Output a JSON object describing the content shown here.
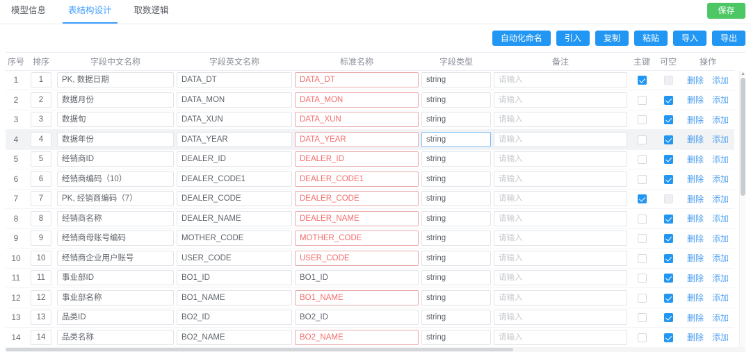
{
  "tabs": [
    {
      "label": "模型信息",
      "active": false
    },
    {
      "label": "表结构设计",
      "active": true
    },
    {
      "label": "取数逻辑",
      "active": false
    }
  ],
  "save_label": "保存",
  "toolbar": {
    "buttons": [
      "自动化命名",
      "引入",
      "复制",
      "粘贴",
      "导入",
      "导出"
    ]
  },
  "table": {
    "headers": [
      "序号",
      "排序",
      "字段中文名称",
      "字段英文名称",
      "标准名称",
      "字段类型",
      "备注",
      "主键",
      "可空",
      "操作"
    ],
    "note_placeholder": "请输入",
    "action_delete": "删除",
    "action_add": "添加",
    "rows": [
      {
        "no": "1",
        "sort": "1",
        "cn": "PK, 数据日期",
        "en": "DATA_DT",
        "std": "DATA_DT",
        "std_err": true,
        "type": "string",
        "type_focus": false,
        "note": "",
        "pk": true,
        "pk_dis": false,
        "nullable": false,
        "null_dis": true,
        "hl": false
      },
      {
        "no": "2",
        "sort": "2",
        "cn": "数据月份",
        "en": "DATA_MON",
        "std": "DATA_MON",
        "std_err": true,
        "type": "string",
        "type_focus": false,
        "note": "",
        "pk": false,
        "pk_dis": false,
        "nullable": true,
        "null_dis": false,
        "hl": false
      },
      {
        "no": "3",
        "sort": "3",
        "cn": "数据旬",
        "en": "DATA_XUN",
        "std": "DATA_XUN",
        "std_err": true,
        "type": "string",
        "type_focus": false,
        "note": "",
        "pk": false,
        "pk_dis": false,
        "nullable": true,
        "null_dis": false,
        "hl": false
      },
      {
        "no": "4",
        "sort": "4",
        "cn": "数据年份",
        "en": "DATA_YEAR",
        "std": "DATA_YEAR",
        "std_err": true,
        "type": "string",
        "type_focus": true,
        "note": "",
        "pk": false,
        "pk_dis": false,
        "nullable": true,
        "null_dis": false,
        "hl": true
      },
      {
        "no": "5",
        "sort": "5",
        "cn": "经销商ID",
        "en": "DEALER_ID",
        "std": "DEALER_ID",
        "std_err": true,
        "type": "string",
        "type_focus": false,
        "note": "",
        "pk": false,
        "pk_dis": false,
        "nullable": true,
        "null_dis": false,
        "hl": false
      },
      {
        "no": "6",
        "sort": "6",
        "cn": "经销商编码（10）",
        "en": "DEALER_CODE1",
        "std": "DEALER_CODE1",
        "std_err": true,
        "type": "string",
        "type_focus": false,
        "note": "",
        "pk": false,
        "pk_dis": false,
        "nullable": true,
        "null_dis": false,
        "hl": false
      },
      {
        "no": "7",
        "sort": "7",
        "cn": "PK, 经销商编码（7）",
        "en": "DEALER_CODE",
        "std": "DEALER_CODE",
        "std_err": true,
        "type": "string",
        "type_focus": false,
        "note": "",
        "pk": true,
        "pk_dis": false,
        "nullable": false,
        "null_dis": true,
        "hl": false
      },
      {
        "no": "8",
        "sort": "8",
        "cn": "经销商名称",
        "en": "DEALER_NAME",
        "std": "DEALER_NAME",
        "std_err": true,
        "type": "string",
        "type_focus": false,
        "note": "",
        "pk": false,
        "pk_dis": false,
        "nullable": true,
        "null_dis": false,
        "hl": false
      },
      {
        "no": "9",
        "sort": "9",
        "cn": "经销商母账号编码",
        "en": "MOTHER_CODE",
        "std": "MOTHER_CODE",
        "std_err": true,
        "type": "string",
        "type_focus": false,
        "note": "",
        "pk": false,
        "pk_dis": false,
        "nullable": true,
        "null_dis": false,
        "hl": false
      },
      {
        "no": "10",
        "sort": "10",
        "cn": "经销商企业用户账号",
        "en": "USER_CODE",
        "std": "USER_CODE",
        "std_err": true,
        "type": "string",
        "type_focus": false,
        "note": "",
        "pk": false,
        "pk_dis": false,
        "nullable": true,
        "null_dis": false,
        "hl": false
      },
      {
        "no": "11",
        "sort": "11",
        "cn": "事业部ID",
        "en": "BO1_ID",
        "std": "BO1_ID",
        "std_err": false,
        "type": "string",
        "type_focus": false,
        "note": "",
        "pk": false,
        "pk_dis": false,
        "nullable": true,
        "null_dis": false,
        "hl": false
      },
      {
        "no": "12",
        "sort": "12",
        "cn": "事业部名称",
        "en": "BO1_NAME",
        "std": "BO1_NAME",
        "std_err": true,
        "type": "string",
        "type_focus": false,
        "note": "",
        "pk": false,
        "pk_dis": false,
        "nullable": true,
        "null_dis": false,
        "hl": false
      },
      {
        "no": "13",
        "sort": "13",
        "cn": "品类ID",
        "en": "BO2_ID",
        "std": "BO2_ID",
        "std_err": false,
        "type": "string",
        "type_focus": false,
        "note": "",
        "pk": false,
        "pk_dis": false,
        "nullable": true,
        "null_dis": false,
        "hl": false
      },
      {
        "no": "14",
        "sort": "14",
        "cn": "品类名称",
        "en": "BO2_NAME",
        "std": "BO2_NAME",
        "std_err": true,
        "type": "string",
        "type_focus": false,
        "note": "",
        "pk": false,
        "pk_dis": false,
        "nullable": true,
        "null_dis": false,
        "hl": false
      }
    ]
  },
  "colors": {
    "accent": "#409eff",
    "button_blue": "#2196f3",
    "save_green": "#4cc764",
    "error_red": "#f56c6c"
  },
  "scroll": {
    "up_arrow": "▲"
  }
}
